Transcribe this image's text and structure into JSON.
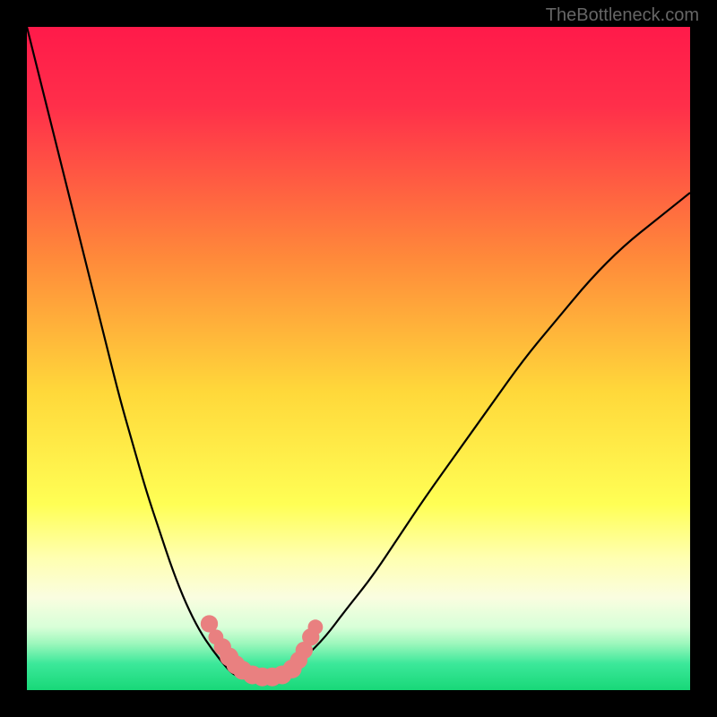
{
  "watermark": "TheBottleneck.com",
  "chart_data": {
    "type": "line",
    "title": "",
    "xlabel": "",
    "ylabel": "",
    "x_range": [
      0,
      100
    ],
    "y_range": [
      0,
      100
    ],
    "gradient_stops": [
      {
        "offset": 0.0,
        "color": "#ff1a4a"
      },
      {
        "offset": 0.12,
        "color": "#ff2f4a"
      },
      {
        "offset": 0.35,
        "color": "#ff8a3a"
      },
      {
        "offset": 0.55,
        "color": "#ffd83a"
      },
      {
        "offset": 0.72,
        "color": "#ffff55"
      },
      {
        "offset": 0.8,
        "color": "#ffffb0"
      },
      {
        "offset": 0.86,
        "color": "#fafde0"
      },
      {
        "offset": 0.905,
        "color": "#d8ffd8"
      },
      {
        "offset": 0.93,
        "color": "#9cf7bc"
      },
      {
        "offset": 0.96,
        "color": "#3ce89a"
      },
      {
        "offset": 1.0,
        "color": "#18d878"
      }
    ],
    "series": [
      {
        "name": "left_curve",
        "x": [
          0,
          2,
          4,
          6,
          8,
          10,
          12,
          14,
          16,
          18,
          20,
          22,
          24,
          26,
          28,
          30,
          31,
          32
        ],
        "y": [
          100,
          92,
          84,
          76,
          68,
          60,
          52,
          44,
          37,
          30,
          24,
          18,
          13,
          9,
          6,
          3.5,
          2.5,
          2
        ]
      },
      {
        "name": "right_curve",
        "x": [
          38,
          40,
          42,
          45,
          48,
          52,
          56,
          60,
          65,
          70,
          75,
          80,
          85,
          90,
          95,
          100
        ],
        "y": [
          2,
          3,
          5,
          8,
          12,
          17,
          23,
          29,
          36,
          43,
          50,
          56,
          62,
          67,
          71,
          75
        ]
      }
    ],
    "markers": [
      {
        "x": 27.5,
        "y": 10,
        "r": 2.3
      },
      {
        "x": 28.5,
        "y": 8,
        "r": 2.0
      },
      {
        "x": 29.5,
        "y": 6.5,
        "r": 2.3
      },
      {
        "x": 30.5,
        "y": 5,
        "r": 2.5
      },
      {
        "x": 31.5,
        "y": 3.8,
        "r": 2.5
      },
      {
        "x": 32.5,
        "y": 3,
        "r": 2.5
      },
      {
        "x": 34,
        "y": 2.3,
        "r": 2.5
      },
      {
        "x": 35.5,
        "y": 2,
        "r": 2.5
      },
      {
        "x": 37,
        "y": 2,
        "r": 2.5
      },
      {
        "x": 38.5,
        "y": 2.3,
        "r": 2.5
      },
      {
        "x": 40,
        "y": 3.2,
        "r": 2.5
      },
      {
        "x": 41,
        "y": 4.5,
        "r": 2.3
      },
      {
        "x": 41.8,
        "y": 6,
        "r": 2.3
      },
      {
        "x": 42.8,
        "y": 8,
        "r": 2.3
      },
      {
        "x": 43.5,
        "y": 9.5,
        "r": 2.0
      }
    ],
    "marker_color": "#e98080",
    "curve_color": "#000000",
    "curve_width": 2.2
  }
}
